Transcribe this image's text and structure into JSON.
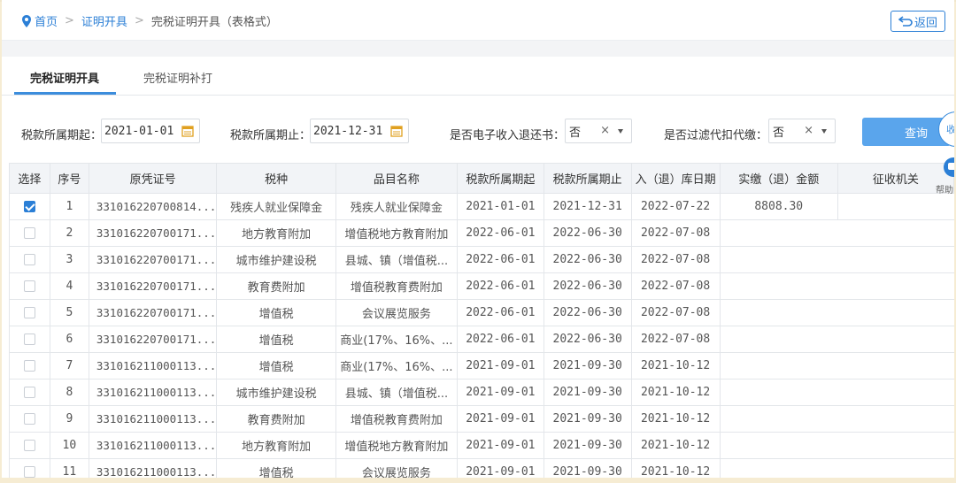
{
  "breadcrumb": {
    "home": "首页",
    "level1": "证明开具",
    "current": "完税证明开具（表格式）"
  },
  "back_button": "返回",
  "tabs": [
    {
      "label": "完税证明开具",
      "active": true
    },
    {
      "label": "完税证明补打",
      "active": false
    }
  ],
  "filters": {
    "start_label": "税款所属期起：",
    "start_value": "2021-01-01",
    "end_label": "税款所属期止：",
    "end_value": "2021-12-31",
    "ereturn_label": "是否电子收入退还书：",
    "ereturn_value": "否",
    "withhold_label": "是否过滤代扣代缴：",
    "withhold_value": "否",
    "clear_glyph": "×",
    "query_button": "查询",
    "collapse_button": "收",
    "help_text": "帮助"
  },
  "table": {
    "headers": [
      "选择",
      "序号",
      "原凭证号",
      "税种",
      "品目名称",
      "税款所属期起",
      "税款所属期止",
      "入（退）库日期",
      "实缴（退）金额",
      "征收机关"
    ],
    "rows": [
      {
        "checked": true,
        "seq": "1",
        "voucher": "331016220700814...",
        "tax": "残疾人就业保障金",
        "item": "残疾人就业保障金",
        "start": "2021-01-01",
        "end": "2021-12-31",
        "date": "2022-07-22",
        "amount": "8808.30",
        "office": ""
      },
      {
        "checked": false,
        "seq": "2",
        "voucher": "331016220700171...",
        "tax": "地方教育附加",
        "item": "增值税地方教育附加",
        "start": "2022-06-01",
        "end": "2022-06-30",
        "date": "2022-07-08",
        "amount": "",
        "office": ""
      },
      {
        "checked": false,
        "seq": "3",
        "voucher": "331016220700171...",
        "tax": "城市维护建设税",
        "item": "县城、镇（增值税...",
        "start": "2022-06-01",
        "end": "2022-06-30",
        "date": "2022-07-08",
        "amount": "",
        "office": ""
      },
      {
        "checked": false,
        "seq": "4",
        "voucher": "331016220700171...",
        "tax": "教育费附加",
        "item": "增值税教育费附加",
        "start": "2022-06-01",
        "end": "2022-06-30",
        "date": "2022-07-08",
        "amount": "",
        "office": ""
      },
      {
        "checked": false,
        "seq": "5",
        "voucher": "331016220700171...",
        "tax": "增值税",
        "item": "会议展览服务",
        "start": "2022-06-01",
        "end": "2022-06-30",
        "date": "2022-07-08",
        "amount": "",
        "office": ""
      },
      {
        "checked": false,
        "seq": "6",
        "voucher": "331016220700171...",
        "tax": "增值税",
        "item": "商业(17%、16%、...",
        "start": "2022-06-01",
        "end": "2022-06-30",
        "date": "2022-07-08",
        "amount": "",
        "office": ""
      },
      {
        "checked": false,
        "seq": "7",
        "voucher": "331016211000113...",
        "tax": "增值税",
        "item": "商业(17%、16%、...",
        "start": "2021-09-01",
        "end": "2021-09-30",
        "date": "2021-10-12",
        "amount": "",
        "office": ""
      },
      {
        "checked": false,
        "seq": "8",
        "voucher": "331016211000113...",
        "tax": "城市维护建设税",
        "item": "县城、镇（增值税...",
        "start": "2021-09-01",
        "end": "2021-09-30",
        "date": "2021-10-12",
        "amount": "",
        "office": ""
      },
      {
        "checked": false,
        "seq": "9",
        "voucher": "331016211000113...",
        "tax": "教育费附加",
        "item": "增值税教育费附加",
        "start": "2021-09-01",
        "end": "2021-09-30",
        "date": "2021-10-12",
        "amount": "",
        "office": ""
      },
      {
        "checked": false,
        "seq": "10",
        "voucher": "331016211000113...",
        "tax": "地方教育附加",
        "item": "增值税地方教育附加",
        "start": "2021-09-01",
        "end": "2021-09-30",
        "date": "2021-10-12",
        "amount": "",
        "office": ""
      },
      {
        "checked": false,
        "seq": "11",
        "voucher": "331016211000113...",
        "tax": "增值税",
        "item": "会议展览服务",
        "start": "2021-09-01",
        "end": "2021-09-30",
        "date": "2021-10-12",
        "amount": "",
        "office": ""
      }
    ]
  },
  "colors": {
    "accent": "#2b7fd6",
    "query_button": "#5aa5ec",
    "header_bg": "#f2f4f7"
  }
}
